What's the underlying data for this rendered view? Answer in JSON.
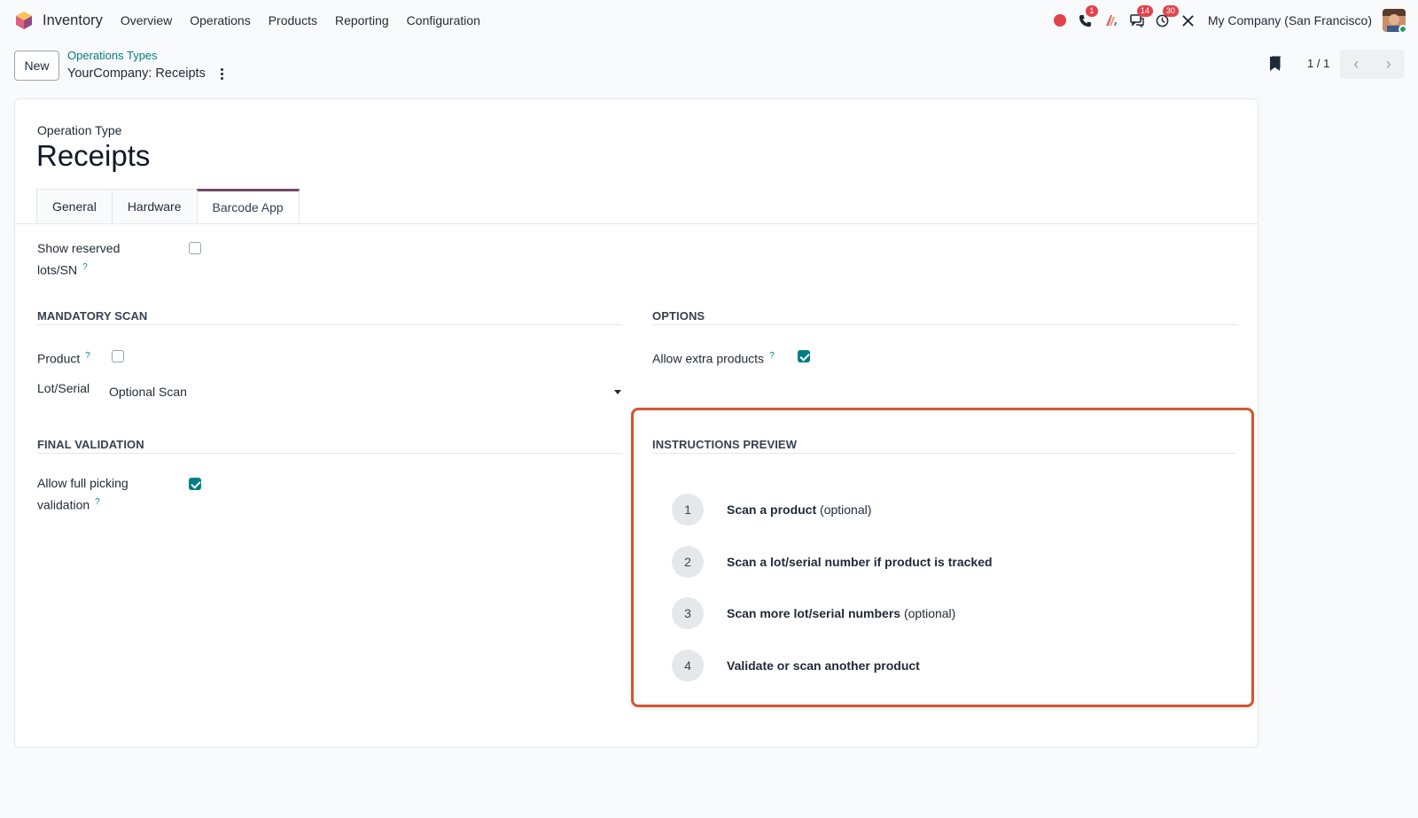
{
  "navbar": {
    "app_name": "Inventory",
    "menu": [
      "Overview",
      "Operations",
      "Products",
      "Reporting",
      "Configuration"
    ],
    "badges": {
      "phone": "1",
      "chat": "14",
      "activity": "30"
    },
    "company": "My Company (San Francisco)"
  },
  "control_panel": {
    "new_label": "New",
    "breadcrumb": "Operations Types",
    "record_title": "YourCompany: Receipts",
    "pager": "1 / 1"
  },
  "form": {
    "op_type_label": "Operation Type",
    "op_name": "Receipts",
    "tabs": [
      "General",
      "Hardware",
      "Barcode App"
    ],
    "active_tab": "Barcode App",
    "show_reserved": {
      "label_line1": "Show reserved",
      "label_line2": "lots/SN",
      "help": "?",
      "checked": false
    },
    "mandatory_scan": {
      "title": "MANDATORY SCAN",
      "product_label": "Product",
      "product_help": "?",
      "product_checked": false,
      "lot_label": "Lot/Serial",
      "lot_value": "Optional Scan"
    },
    "options": {
      "title": "OPTIONS",
      "allow_extra_label": "Allow extra products",
      "allow_extra_help": "?",
      "allow_extra_checked": true
    },
    "final_validation": {
      "title": "FINAL VALIDATION",
      "label_line1": "Allow full picking",
      "label_line2": "validation",
      "help": "?",
      "checked": true
    },
    "instructions": {
      "title": "INSTRUCTIONS PREVIEW",
      "steps": [
        {
          "num": "1",
          "bold": "Scan a product",
          "rest": " (optional)"
        },
        {
          "num": "2",
          "bold": "Scan a lot/serial number if product is tracked",
          "rest": ""
        },
        {
          "num": "3",
          "bold": "Scan more lot/serial numbers",
          "rest": " (optional)"
        },
        {
          "num": "4",
          "bold": "Validate or scan another product",
          "rest": ""
        }
      ]
    }
  },
  "colors": {
    "accent": "#017e84",
    "brand": "#714b67",
    "highlight_border": "#d2562e",
    "badge": "#e0434b"
  }
}
